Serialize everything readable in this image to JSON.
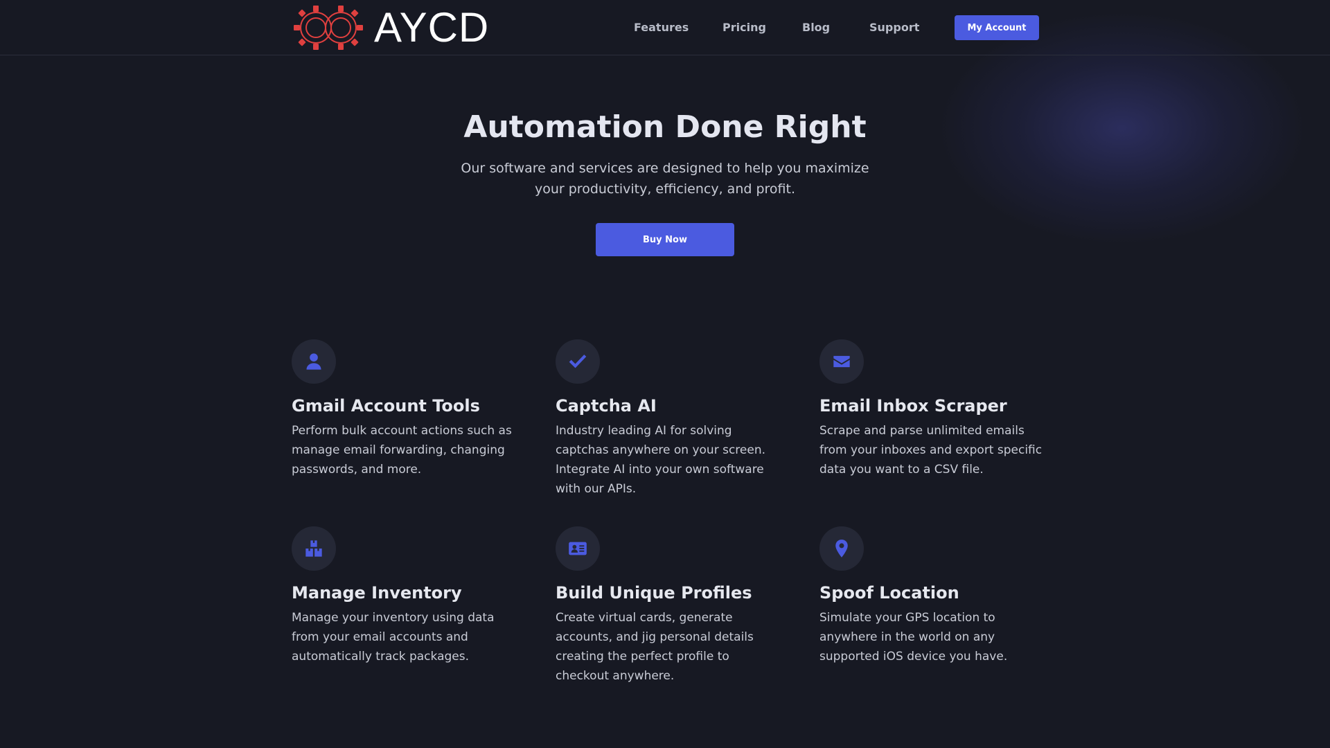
{
  "brand": {
    "name": "AYCD",
    "logo_color": "#e0403f"
  },
  "nav": {
    "links": [
      "Features",
      "Pricing",
      "Blog",
      "Support"
    ],
    "account_label": "My Account"
  },
  "hero": {
    "title": "Automation Done Right",
    "subtitle": "Our software and services are designed to help you maximize your productivity, efficiency, and profit.",
    "cta_label": "Buy Now"
  },
  "features": [
    {
      "icon": "user-icon",
      "title": "Gmail Account Tools",
      "description": "Perform bulk account actions such as manage email forwarding, changing passwords, and more."
    },
    {
      "icon": "check-icon",
      "title": "Captcha AI",
      "description": "Industry leading AI for solving captchas anywhere on your screen. Integrate AI into your own software with our APIs."
    },
    {
      "icon": "envelope-icon",
      "title": "Email Inbox Scraper",
      "description": "Scrape and parse unlimited emails from your inboxes and export specific data you want to a CSV file."
    },
    {
      "icon": "boxes-icon",
      "title": "Manage Inventory",
      "description": "Manage your inventory using data from your email accounts and automatically track packages."
    },
    {
      "icon": "id-card-icon",
      "title": "Build Unique Profiles",
      "description": "Create virtual cards, generate accounts, and jig personal details creating the perfect profile to checkout anywhere."
    },
    {
      "icon": "map-pin-icon",
      "title": "Spoof Location",
      "description": "Simulate your GPS location to anywhere in the world on any supported iOS device you have."
    }
  ],
  "colors": {
    "accent": "#4b5be0",
    "background": "#171923",
    "icon_bg": "#252836"
  }
}
